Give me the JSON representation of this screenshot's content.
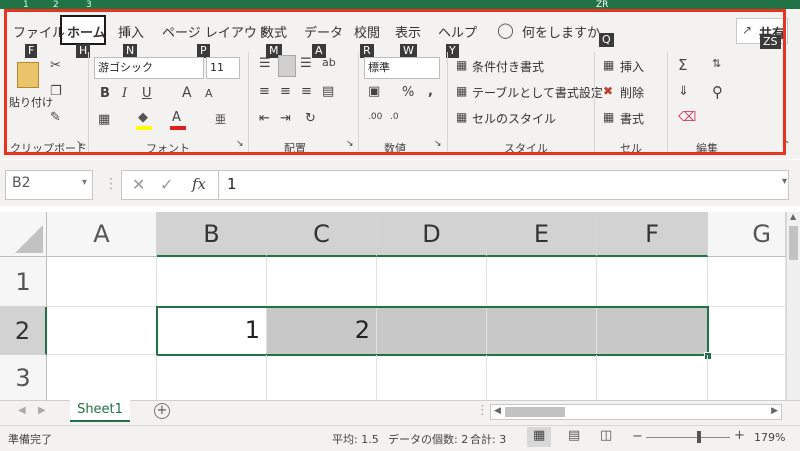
{
  "window": {
    "keytips_top": [
      "1",
      "2",
      "3"
    ],
    "keytip_zr": "ZR"
  },
  "ribbon": {
    "tabs": [
      {
        "label": "ファイル",
        "keytip": "F"
      },
      {
        "label": "ホーム",
        "keytip": "H"
      },
      {
        "label": "挿入",
        "keytip": "N"
      },
      {
        "label": "ページ レイアウト",
        "keytip": "P"
      },
      {
        "label": "数式",
        "keytip": "M"
      },
      {
        "label": "データ",
        "keytip": "A"
      },
      {
        "label": "校閲",
        "keytip": "R"
      },
      {
        "label": "表示",
        "keytip": "W"
      },
      {
        "label": "ヘルプ",
        "keytip": "Y"
      }
    ],
    "tell_me": "何をしますか",
    "tell_me_keytip": "Q",
    "share_label": "共有",
    "share_keytip": "ZS",
    "clipboard": {
      "paste": "貼り付け",
      "label": "クリップボード"
    },
    "font": {
      "name": "游ゴシック",
      "size": "11",
      "label": "フォント",
      "bold": "B",
      "italic": "I",
      "underline": "U",
      "grow": "A",
      "shrink": "A",
      "font_color": "A",
      "phonetic": "亜"
    },
    "alignment": {
      "label": "配置"
    },
    "number": {
      "format": "標準",
      "label": "数値",
      "percent": "%",
      "comma": ","
    },
    "styles": {
      "conditional": "条件付き書式",
      "table": "テーブルとして書式設定",
      "cell_styles": "セルのスタイル",
      "label": "スタイル"
    },
    "cells": {
      "insert": "挿入",
      "delete": "削除",
      "format": "書式",
      "label": "セル"
    },
    "editing": {
      "label": "編集"
    }
  },
  "formula_bar": {
    "name_box": "B2",
    "fx": "fx",
    "value": "1"
  },
  "grid": {
    "columns": [
      "A",
      "B",
      "C",
      "D",
      "E",
      "F",
      "G"
    ],
    "rows": [
      "1",
      "2",
      "3"
    ],
    "cells": {
      "B2": "1",
      "C2": "2"
    }
  },
  "sheets": {
    "active": "Sheet1"
  },
  "status": {
    "ready": "準備完了",
    "average": "平均: 1.5",
    "count": "データの個数: 2",
    "sum": "合計: 3",
    "zoom": "179%"
  },
  "colors": {
    "accent": "#217346",
    "highlight_border": "#e8331e"
  }
}
